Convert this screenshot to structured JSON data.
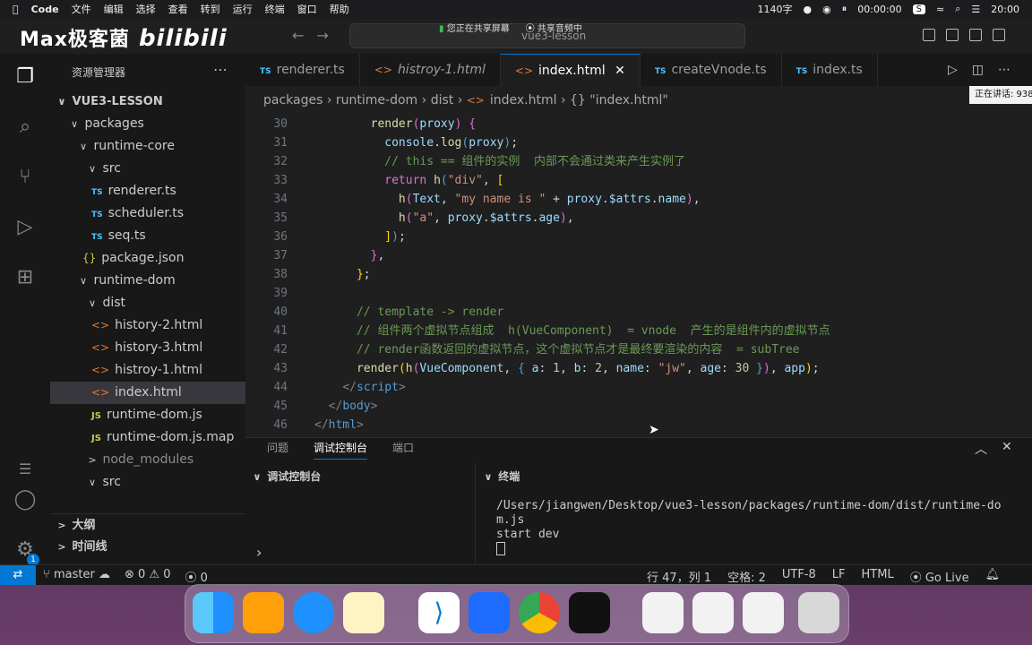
{
  "menubar": {
    "app": "Code",
    "items": [
      "文件",
      "编辑",
      "选择",
      "查看",
      "转到",
      "运行",
      "终端",
      "窗口",
      "帮助"
    ],
    "char_count": "1140字",
    "timer": "00:00:00",
    "clock": "20:00"
  },
  "titlebar": {
    "logo_text": "Max极客菌",
    "logo_brand": "bilibili",
    "search_text": "vue3-lesson",
    "share_screen": "您正在共享屏幕",
    "share_audio": "共享音频中",
    "speaking": "正在讲话: 938"
  },
  "sidebar": {
    "title": "资源管理器",
    "tree": [
      {
        "label": "VUE3-LESSON",
        "kind": "root"
      },
      {
        "label": "packages",
        "kind": "folder"
      },
      {
        "label": "runtime-core",
        "kind": "folder"
      },
      {
        "label": "src",
        "kind": "folder"
      },
      {
        "label": "renderer.ts",
        "kind": "ts"
      },
      {
        "label": "scheduler.ts",
        "kind": "ts"
      },
      {
        "label": "seq.ts",
        "kind": "ts"
      },
      {
        "label": "package.json",
        "kind": "json"
      },
      {
        "label": "runtime-dom",
        "kind": "folder"
      },
      {
        "label": "dist",
        "kind": "folder"
      },
      {
        "label": "history-2.html",
        "kind": "html"
      },
      {
        "label": "history-3.html",
        "kind": "html"
      },
      {
        "label": "histroy-1.html",
        "kind": "html"
      },
      {
        "label": "index.html",
        "kind": "html"
      },
      {
        "label": "runtime-dom.js",
        "kind": "js"
      },
      {
        "label": "runtime-dom.js.map",
        "kind": "js"
      },
      {
        "label": "node_modules",
        "kind": "folder-closed"
      },
      {
        "label": "src",
        "kind": "folder"
      }
    ],
    "outline": "大纲",
    "timeline": "时间线"
  },
  "tabs": [
    "renderer.ts",
    "histroy-1.html",
    "index.html",
    "createVnode.ts",
    "index.ts"
  ],
  "breadcrumb": [
    "packages",
    "runtime-dom",
    "dist",
    "index.html",
    "{} \"index.html\""
  ],
  "code": {
    "line_numbers": [
      "30",
      "31",
      "32",
      "33",
      "34",
      "35",
      "36",
      "37",
      "38",
      "39",
      "40",
      "41",
      "42",
      "43",
      "44",
      "45",
      "46"
    ]
  },
  "panel": {
    "tabs": [
      "问题",
      "调试控制台",
      "端口"
    ],
    "debug_title": "调试控制台",
    "terminal_title": "终端",
    "terminal_lines": [
      "/Users/jiangwen/Desktop/vue3-lesson/packages/runtime-dom/dist/runtime-do",
      "m.js",
      "start dev"
    ]
  },
  "statusbar": {
    "branch": "master",
    "errors": "0",
    "warnings": "0",
    "ports": "0",
    "position": "行 47，列 1",
    "spaces": "空格: 2",
    "encoding": "UTF-8",
    "eol": "LF",
    "language": "HTML",
    "golive": "Go Live"
  }
}
